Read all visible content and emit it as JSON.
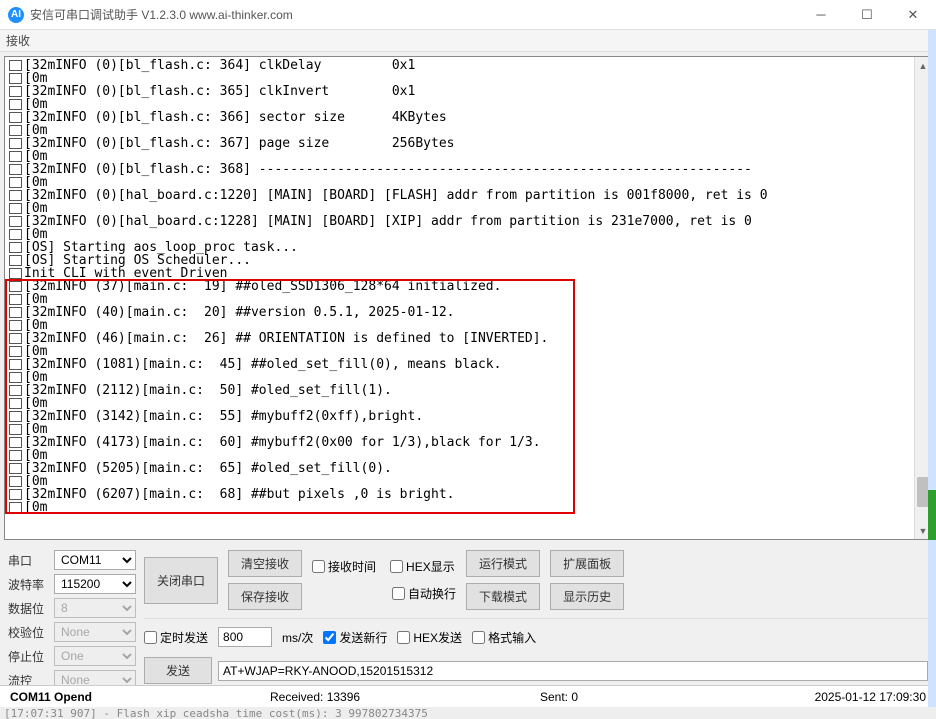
{
  "window": {
    "logo_text": "AI",
    "title": "安信可串口调试助手 V1.2.3.0     www.ai-thinker.com"
  },
  "receive_label": "接收",
  "log_lines": [
    "[32mINFO (0)[bl_flash.c: 364] clkDelay         0x1",
    "[0m",
    "[32mINFO (0)[bl_flash.c: 365] clkInvert        0x1",
    "[0m",
    "[32mINFO (0)[bl_flash.c: 366] sector size      4KBytes",
    "[0m",
    "[32mINFO (0)[bl_flash.c: 367] page size        256Bytes",
    "[0m",
    "[32mINFO (0)[bl_flash.c: 368] ---------------------------------------------------------------",
    "[0m",
    "[32mINFO (0)[hal_board.c:1220] [MAIN] [BOARD] [FLASH] addr from partition is 001f8000, ret is 0",
    "[0m",
    "[32mINFO (0)[hal_board.c:1228] [MAIN] [BOARD] [XIP] addr from partition is 231e7000, ret is 0",
    "[0m",
    "[OS] Starting aos_loop_proc task...",
    "[OS] Starting OS Scheduler...",
    "Init CLI with event Driven",
    "[32mINFO (37)[main.c:  19] ##oled_SSD1306_128*64 initialized.",
    "[0m",
    "[32mINFO (40)[main.c:  20] ##version 0.5.1, 2025-01-12.",
    "[0m",
    "[32mINFO (46)[main.c:  26] ## ORIENTATION is defined to [INVERTED].",
    "[0m",
    "[32mINFO (1081)[main.c:  45] ##oled_set_fill(0), means black.",
    "[0m",
    "[32mINFO (2112)[main.c:  50] #oled_set_fill(1).",
    "[0m",
    "[32mINFO (3142)[main.c:  55] #mybuff2(0xff),bright.",
    "[0m",
    "[32mINFO (4173)[main.c:  60] #mybuff2(0x00 for 1/3),black for 1/3.",
    "[0m",
    "[32mINFO (5205)[main.c:  65] #oled_set_fill(0).",
    "[0m",
    "[32mINFO (6207)[main.c:  68] ##but pixels ,0 is bright.",
    "[0m"
  ],
  "settings": {
    "port_label": "串口",
    "port_value": "COM11",
    "baud_label": "波特率",
    "baud_value": "115200",
    "databits_label": "数据位",
    "databits_value": "8",
    "parity_label": "校验位",
    "parity_value": "None",
    "stopbits_label": "停止位",
    "stopbits_value": "One",
    "flow_label": "流控",
    "flow_value": "None"
  },
  "buttons": {
    "close_port": "关闭串口",
    "clear_recv": "清空接收",
    "save_recv": "保存接收",
    "run_mode": "运行模式",
    "down_mode": "下载模式",
    "ext_panel": "扩展面板",
    "history": "显示历史",
    "send": "发送"
  },
  "checks": {
    "recv_time": "接收时间",
    "hex_show": "HEX显示",
    "auto_wrap": "自动换行",
    "timed_send": "定时发送",
    "send_newline": "发送新行",
    "hex_send": "HEX发送",
    "fmt_input": "格式输入"
  },
  "timed": {
    "interval_value": "800",
    "interval_unit": "ms/次"
  },
  "send_text": "AT+WJAP=RKY-ANOOD,15201515312",
  "status": {
    "port": "COM11 Opend",
    "received_label": "Received: ",
    "received_value": "13396",
    "sent_label": "Sent: ",
    "sent_value": "0",
    "time": "2025-01-12 17:09:30"
  },
  "tail_text": "[17:07:31 907] - Flash xip ceadsha time cost(ms): 3 997802734375"
}
